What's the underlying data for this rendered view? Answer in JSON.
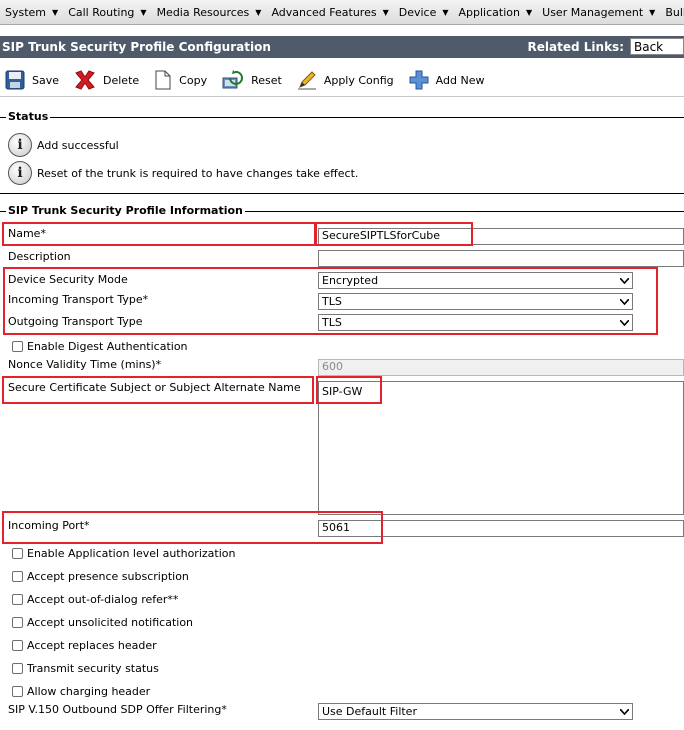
{
  "menu": {
    "items": [
      {
        "name": "menu-system",
        "label": "System"
      },
      {
        "name": "menu-call-routing",
        "label": "Call Routing"
      },
      {
        "name": "menu-media-resources",
        "label": "Media Resources"
      },
      {
        "name": "menu-advanced-features",
        "label": "Advanced Features"
      },
      {
        "name": "menu-device",
        "label": "Device"
      },
      {
        "name": "menu-application",
        "label": "Application"
      },
      {
        "name": "menu-user-management",
        "label": "User Management"
      },
      {
        "name": "menu-bulk",
        "label": "Bulk A"
      }
    ]
  },
  "header": {
    "title": "SIP Trunk Security Profile Configuration",
    "related_links_label": "Related Links:",
    "related_links_value": "Back"
  },
  "toolbar": {
    "save": "Save",
    "delete": "Delete",
    "copy": "Copy",
    "reset": "Reset",
    "apply_config": "Apply Config",
    "add_new": "Add New"
  },
  "status": {
    "legend": "Status",
    "messages": [
      "Add successful",
      "Reset of the trunk is required to have changes take effect."
    ]
  },
  "info": {
    "legend": "SIP Trunk Security Profile Information",
    "name_label": "Name",
    "name_value": "SecureSIPTLSforCube",
    "description_label": "Description",
    "description_value": "",
    "device_security_mode_label": "Device Security Mode",
    "device_security_mode_value": "Encrypted",
    "incoming_transport_label": "Incoming Transport Type",
    "incoming_transport_value": "TLS",
    "outgoing_transport_label": "Outgoing Transport Type",
    "outgoing_transport_value": "TLS",
    "enable_digest_label": "Enable Digest Authentication",
    "nonce_label": "Nonce Validity Time (mins)",
    "nonce_value": "600",
    "secure_cert_label": "Secure Certificate Subject or Subject Alternate Name",
    "secure_cert_value": "SIP-GW",
    "incoming_port_label": "Incoming Port",
    "incoming_port_value": "5061",
    "checkboxes": [
      "Enable Application level authorization",
      "Accept presence subscription",
      "Accept out-of-dialog refer",
      "Accept unsolicited notification",
      "Accept replaces header",
      "Transmit security status",
      "Allow charging header"
    ],
    "required_mark": "*",
    "double_mark": "**",
    "sdp_filter_label": "SIP V.150 Outbound SDP Offer Filtering",
    "sdp_filter_value": "Use Default Filter"
  },
  "colors": {
    "title_bar": "#4f5b6b",
    "highlight": "#e3232c"
  }
}
